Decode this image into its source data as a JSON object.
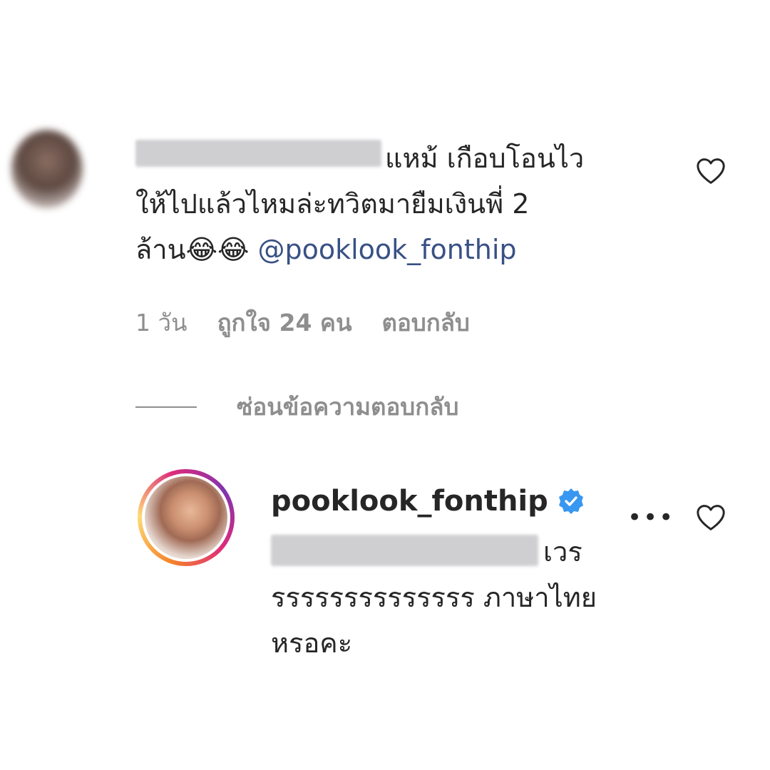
{
  "comment": {
    "text_line1": "แหม้ เกือบโอนไว",
    "text_line2": "ให้ไปแล้วไหมล่ะทวิตมายืมเงินพี่ 2",
    "text_line3": "ล้าน😂😂 ",
    "mention": "@pooklook_fonthip",
    "time": "1 วัน",
    "likes": "ถูกใจ 24 คน",
    "reply_label": "ตอบกลับ",
    "hide_replies": "ซ่อนข้อความตอบกลับ"
  },
  "reply": {
    "username": "pooklook_fonthip",
    "text_line1": "เวร",
    "text_line2": "รรรรรรรรรรรรรร ภาษาไทย",
    "text_line3": "หรอคะ",
    "more": "•••"
  },
  "colors": {
    "mention": "#385185",
    "verified": "#3897f0",
    "muted": "#8e8e8e"
  }
}
